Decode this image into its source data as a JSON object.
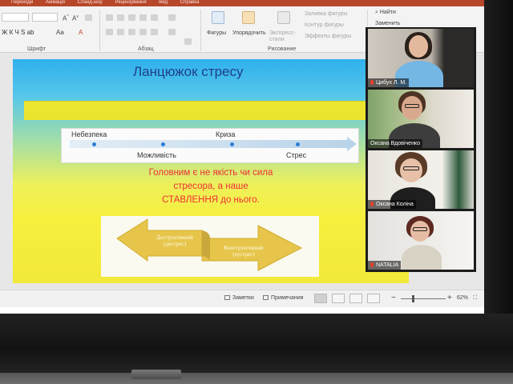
{
  "ribbon": {
    "tabs": [
      "Переходи",
      "Анімація",
      "Слайд-шоу",
      "Рецензування",
      "Вид",
      "Справка"
    ],
    "groups": {
      "font": "Шрифт",
      "paragraph": "Абзац",
      "drawing": "Рисование"
    },
    "font_size_box": "Aa",
    "figures_label": "Фигуры",
    "arrange_label": "Упорядочить",
    "quick_styles_label": "Экспресс-стили",
    "fill_label": "Заливка фигуры",
    "outline_label": "Контур фигуры",
    "effects_label": "Эффекты фигуры",
    "find_label": "Найти",
    "replace_label": "Заменить"
  },
  "slide": {
    "title": "Ланцюжок стресу",
    "timeline": {
      "top_labels": [
        "Небезпека",
        "Криза"
      ],
      "bottom_labels": [
        "Можливість",
        "Стрес"
      ]
    },
    "main_text": [
      "Головним є не якість чи сила",
      "стресора, а наше",
      "СТАВЛЕННЯ до нього."
    ],
    "arrow_left_label": [
      "Деструктивний",
      "(дистрес)"
    ],
    "arrow_right_label": [
      "Конструктивний",
      "(еустрес)"
    ]
  },
  "participants": [
    {
      "name": "Цибух Л. М."
    },
    {
      "name": "Оксана Вдовіченко"
    },
    {
      "name": "Оксана Коліна"
    },
    {
      "name": "NATALIA"
    }
  ],
  "status_bar": {
    "notes_label": "Заметки",
    "comments_label": "Примечания",
    "zoom_text": "62%",
    "zoom_minus": "−",
    "zoom_plus": "+"
  },
  "colors": {
    "ribbon_accent": "#b7472a",
    "title_color": "#1f3e8c",
    "main_text_color": "#ef2f36",
    "arrow_fill": "#e6c54a"
  }
}
